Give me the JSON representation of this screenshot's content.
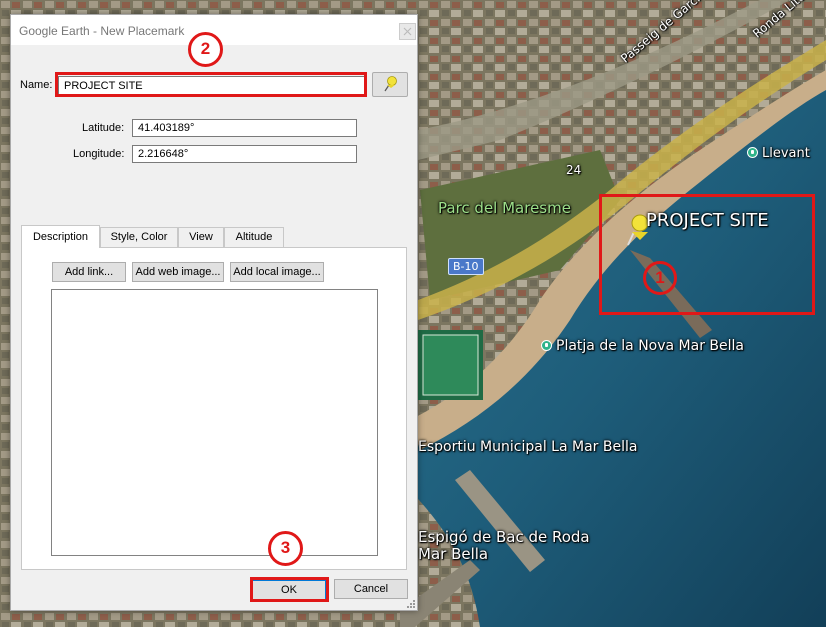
{
  "dialog": {
    "title": "Google Earth - New Placemark",
    "name_label": "Name:",
    "name_value": "PROJECT SITE",
    "latitude_label": "Latitude:",
    "latitude_value": "41.403189°",
    "longitude_label": "Longitude:",
    "longitude_value": "2.216648°",
    "tabs": [
      {
        "label": "Description",
        "active": true
      },
      {
        "label": "Style, Color",
        "active": false
      },
      {
        "label": "View",
        "active": false
      },
      {
        "label": "Altitude",
        "active": false
      }
    ],
    "buttons": {
      "add_link": "Add link...",
      "add_web_image": "Add web image...",
      "add_local_image": "Add local image...",
      "ok": "OK",
      "cancel": "Cancel"
    },
    "description_value": ""
  },
  "map": {
    "placemark_label": "PROJECT SITE",
    "labels": {
      "street_garcia_faria": "Passeig de Garcia Fària",
      "street_litoral": "Ronda Litoral",
      "road_24": "24",
      "road_b10": "B-10",
      "park": "Parc del Maresme",
      "llevant": "Llevant",
      "beach_nova_mar_bella": "Platja de la Nova Mar Bella",
      "sports_center": "Esportiu Municipal La Mar Bella",
      "breakwater_bac_de_roda": "Espigó de Bac de Roda",
      "mar_bella": "Mar Bella"
    }
  },
  "annotations": {
    "step_1": "1",
    "step_2": "2",
    "step_3": "3",
    "color": "#e01818"
  },
  "colors": {
    "sea": "#1e5d7a",
    "pushpin": "#f2e23a"
  }
}
